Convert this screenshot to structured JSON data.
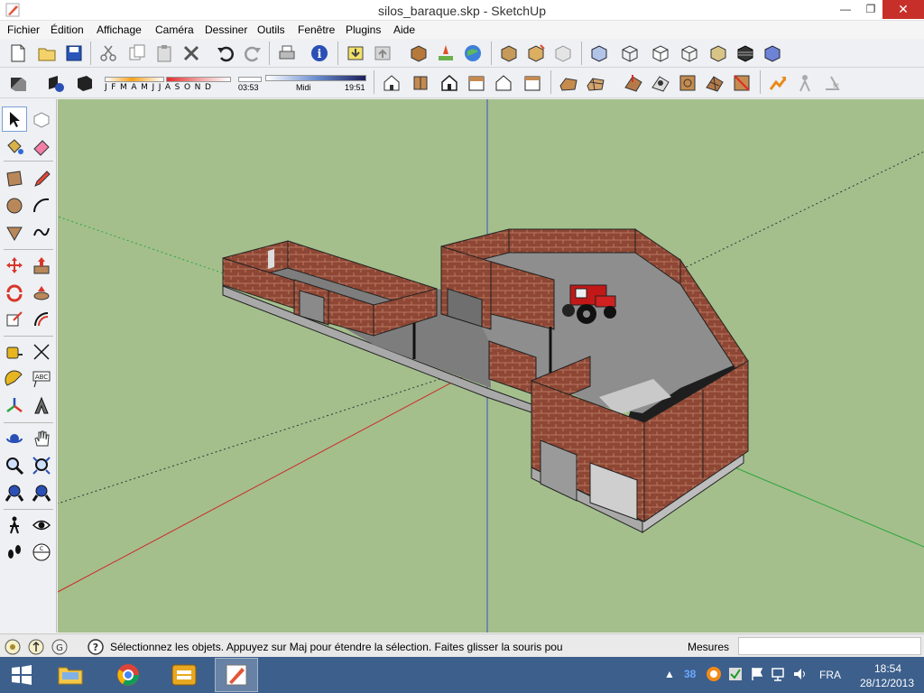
{
  "window": {
    "title": "silos_baraque.skp - SketchUp",
    "minimize": "—",
    "maximize": "❐",
    "close": "✕"
  },
  "menu": [
    "Fichier",
    "Édition",
    "Affichage",
    "Caméra",
    "Dessiner",
    "Outils",
    "Fenêtre",
    "Plugins",
    "Aide"
  ],
  "shadow_settings": {
    "months": "JFMAMJJASOND",
    "hour_start": "03:53",
    "hour_mid": "Midi",
    "hour_end": "19:51"
  },
  "statusbar": {
    "status_text": "Sélectionnez les objets. Appuyez sur Maj pour étendre la sélection. Faites glisser la souris pou",
    "measure_label": "Mesures",
    "measure_value": ""
  },
  "taskbar": {
    "language": "FRA",
    "time": "18:54",
    "date": "28/12/2013",
    "tray_badge": "38"
  },
  "colors": {
    "viewport_bg": "#a4bf8c",
    "brick": "#8e4734",
    "floor": "#8a8a8a",
    "axis_red": "#cc2a2a",
    "axis_green": "#2aa63c",
    "axis_blue": "#3d4fc8",
    "taskbar": "#3d5f8c",
    "close_button": "#c7302a"
  }
}
